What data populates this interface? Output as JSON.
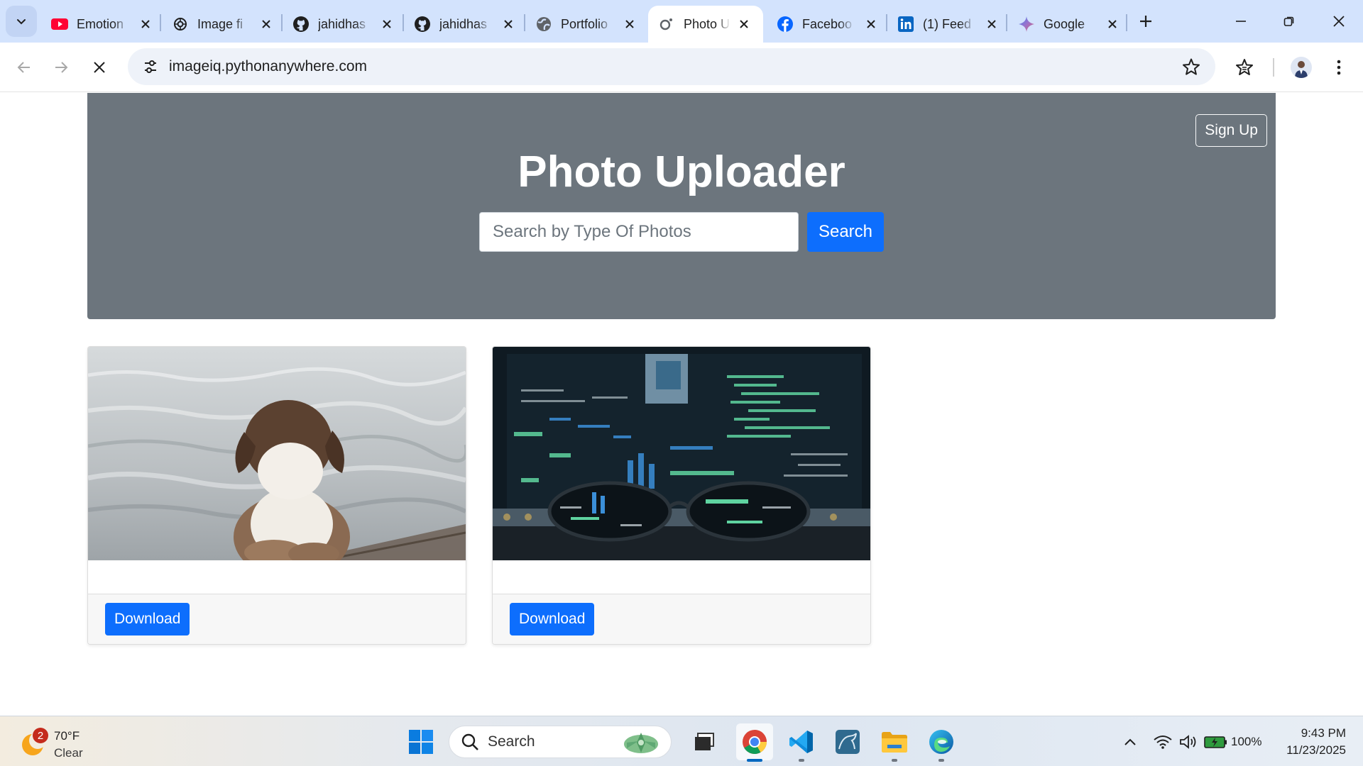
{
  "browser": {
    "tabs": [
      {
        "title": "Emotion",
        "icon": "youtube-icon"
      },
      {
        "title": "Image fi",
        "icon": "chatgpt-icon"
      },
      {
        "title": "jahidhas",
        "icon": "github-icon"
      },
      {
        "title": "jahidhas",
        "icon": "github-icon"
      },
      {
        "title": "Portfolio",
        "icon": "globe-icon"
      },
      {
        "title": "Photo U",
        "icon": "loading-icon",
        "active": true
      },
      {
        "title": "Faceboo",
        "icon": "facebook-icon"
      },
      {
        "title": "(1) Feed",
        "icon": "linkedin-icon"
      },
      {
        "title": "Google",
        "icon": "gemini-icon"
      }
    ],
    "url": "imageiq.pythonanywhere.com"
  },
  "page": {
    "hero": {
      "signup_label": "Sign Up",
      "title": "Photo Uploader",
      "search_placeholder": "Search by Type Of Photos",
      "search_button": "Search"
    },
    "cards": [
      {
        "image": "dog-by-water",
        "download_label": "Download"
      },
      {
        "image": "glasses-in-front-of-code-monitor",
        "download_label": "Download"
      }
    ]
  },
  "taskbar": {
    "weather": {
      "badge": "2",
      "temp": "70°F",
      "condition": "Clear"
    },
    "search_label": "Search",
    "battery": "100%",
    "time": "9:43 PM",
    "date": "11/23/2025"
  },
  "colors": {
    "tab_strip": "#d3e3fd",
    "hero_bg": "#6c757d",
    "primary_button": "#0d6efd"
  }
}
